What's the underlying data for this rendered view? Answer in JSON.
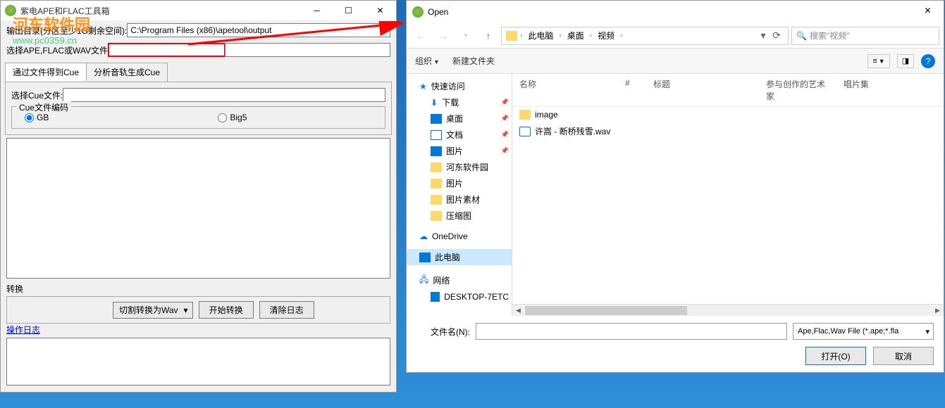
{
  "leftWindow": {
    "title": "紫电APE和FLAC工具箱",
    "outputLabel": "输出目录(分区至少1G剩余空间):",
    "outputPath": "C:\\Program Files (x86)\\apetool\\output",
    "selectFileLabel": "选择APE,FLAC或WAV文件",
    "selectFileValue": "",
    "tabs": {
      "tab1": "通过文件得到Cue",
      "tab2": "分析音轨生成Cue"
    },
    "cueLabel": "选择Cue文件:",
    "cueValue": "",
    "encodingGroup": "Cue文件编码",
    "encGB": "GB",
    "encBig5": "Big5",
    "convertLabel": "转换",
    "convertMode": "切割转换为Wav",
    "startBtn": "开始转换",
    "clearBtn": "清除日志",
    "logLabel": "操作日志"
  },
  "watermark": {
    "cn": "河东软件园",
    "url": "www.pc0359.cn"
  },
  "openDialog": {
    "title": "Open",
    "breadcrumb": {
      "pc": "此电脑",
      "desktop": "桌面",
      "video": "视频"
    },
    "searchPlaceholder": "搜索\"视频\"",
    "toolbar": {
      "organize": "组织",
      "newFolder": "新建文件夹"
    },
    "columns": {
      "name": "名称",
      "num": "#",
      "title": "标题",
      "artist": "参与创作的艺术家",
      "album": "唱片集"
    },
    "tree": {
      "quickAccess": "快速访问",
      "downloads": "下载",
      "desktop": "桌面",
      "documents": "文档",
      "pictures": "图片",
      "hedong": "河东软件园",
      "pictures2": "图片",
      "picMaterial": "图片素材",
      "thumbnails": "压缩图",
      "onedrive": "OneDrive",
      "thispc": "此电脑",
      "network": "网络",
      "desktopNode": "DESKTOP-7ETC"
    },
    "files": {
      "folder1": "image",
      "file1": "许嵩 - 断桥残雪.wav"
    },
    "footer": {
      "fileNameLabel": "文件名(N):",
      "fileNameValue": "",
      "filter": "Ape,Flac,Wav File (*.ape;*.fla",
      "openBtn": "打开(O)",
      "cancelBtn": "取消"
    }
  }
}
